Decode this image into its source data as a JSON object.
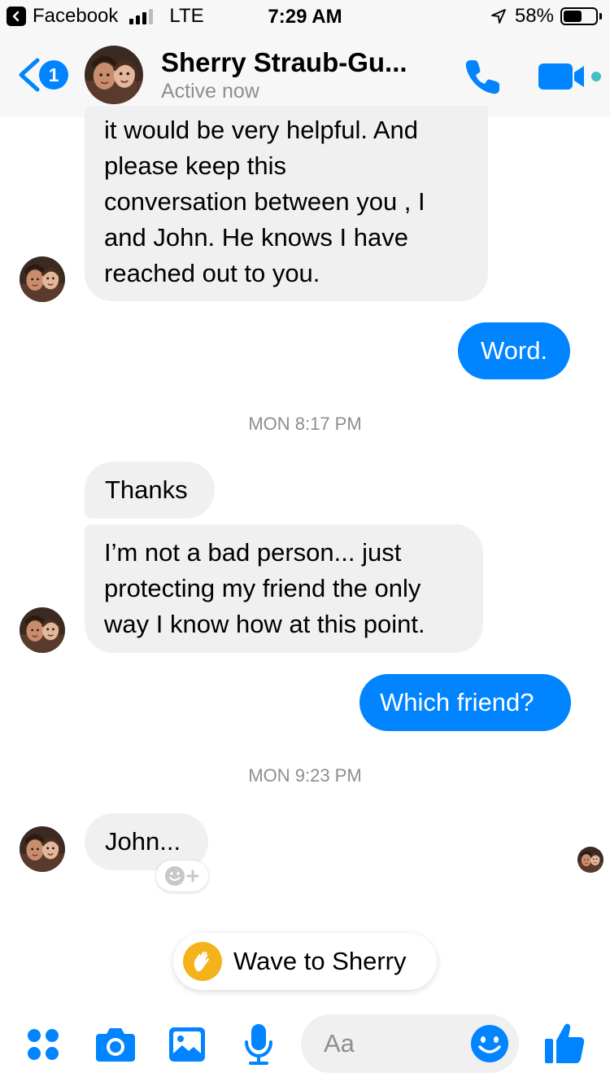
{
  "status_bar": {
    "back_app": "Facebook",
    "network": "LTE",
    "time": "7:29 AM",
    "battery": "58%",
    "battery_level": 0.58
  },
  "header": {
    "unread_count": "1",
    "contact_name": "Sherry Straub-Gu...",
    "status": "Active now"
  },
  "messages": [
    {
      "direction": "incoming",
      "text_lines": [
        "it would be very helpful. And",
        "please keep this",
        "conversation between you , I",
        "and John. He knows I have",
        "reached out to you."
      ]
    },
    {
      "direction": "outgoing",
      "text": "Word."
    },
    {
      "type": "timestamp",
      "text": "MON 8:17 PM"
    },
    {
      "direction": "incoming",
      "text": "Thanks"
    },
    {
      "direction": "incoming",
      "text_lines": [
        "I’m not a bad person... just",
        "protecting my friend the only",
        "way I know how at this point."
      ]
    },
    {
      "direction": "outgoing",
      "text": "Which friend?"
    },
    {
      "type": "timestamp",
      "text": "MON 9:23 PM"
    },
    {
      "direction": "incoming",
      "text": "John..."
    }
  ],
  "wave_button": {
    "label": "Wave to Sherry"
  },
  "composer": {
    "placeholder": "Aa"
  },
  "colors": {
    "accent": "#0084ff",
    "incoming_bubble": "#f1f0f0",
    "active_dot": "#44bec7"
  },
  "icons": [
    "back-chevron-icon",
    "phone-icon",
    "video-camera-icon",
    "apps-grid-icon",
    "camera-icon",
    "photo-gallery-icon",
    "microphone-icon",
    "emoji-icon",
    "thumbs-up-icon",
    "add-reaction-icon",
    "waving-hand-icon",
    "location-arrow-icon"
  ]
}
